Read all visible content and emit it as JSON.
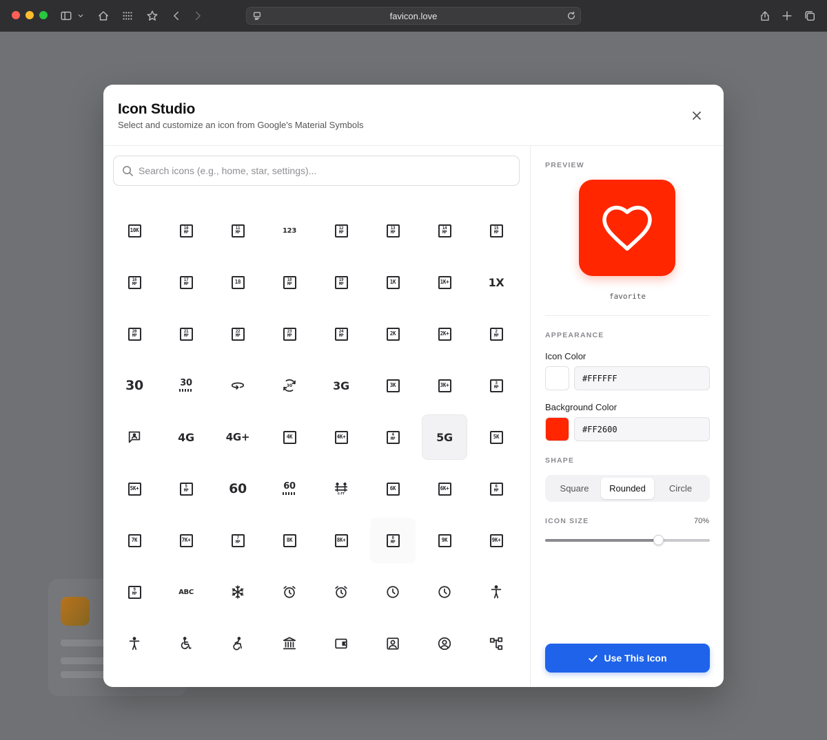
{
  "browser": {
    "url": "favicon.love"
  },
  "modal": {
    "title": "Icon Studio",
    "subtitle": "Select and customize an icon from Google's Material Symbols",
    "close_icon": "close-icon"
  },
  "search": {
    "placeholder": "Search icons (e.g., home, star, settings)...",
    "value": ""
  },
  "icons": [
    {
      "label": "10K",
      "kind": "box"
    },
    {
      "label": "10 MP",
      "kind": "boxmp"
    },
    {
      "label": "11 MP",
      "kind": "boxmp"
    },
    {
      "label": "123",
      "kind": "text",
      "size": 10
    },
    {
      "label": "12 MP",
      "kind": "boxmp"
    },
    {
      "label": "13 MP",
      "kind": "boxmp"
    },
    {
      "label": "14 MP",
      "kind": "boxmp"
    },
    {
      "label": "15 MP",
      "kind": "boxmp"
    },
    {
      "label": "16 MP",
      "kind": "boxmp"
    },
    {
      "label": "17 MP",
      "kind": "boxmp"
    },
    {
      "label": "18",
      "kind": "box"
    },
    {
      "label": "18 MP",
      "kind": "boxmp"
    },
    {
      "label": "19 MP",
      "kind": "boxmp"
    },
    {
      "label": "1K",
      "kind": "box"
    },
    {
      "label": "1K+",
      "kind": "box"
    },
    {
      "label": "1X",
      "kind": "text",
      "size": 16
    },
    {
      "label": "20 MP",
      "kind": "boxmp"
    },
    {
      "label": "21 MP",
      "kind": "boxmp"
    },
    {
      "label": "22 MP",
      "kind": "boxmp"
    },
    {
      "label": "23 MP",
      "kind": "boxmp"
    },
    {
      "label": "24 MP",
      "kind": "boxmp"
    },
    {
      "label": "2K",
      "kind": "box"
    },
    {
      "label": "2K+",
      "kind": "box"
    },
    {
      "label": "2 MP",
      "kind": "boxmp"
    },
    {
      "label": "30",
      "kind": "text",
      "size": 19
    },
    {
      "label": "30",
      "kind": "text30"
    },
    {
      "label": "360",
      "kind": "svg",
      "svg": "rot360"
    },
    {
      "label": "3D",
      "kind": "svg",
      "svg": "rot3d"
    },
    {
      "label": "3G",
      "kind": "text",
      "size": 16
    },
    {
      "label": "3K",
      "kind": "box"
    },
    {
      "label": "3K+",
      "kind": "box"
    },
    {
      "label": "3 MP",
      "kind": "boxmp"
    },
    {
      "label": "",
      "kind": "svg",
      "svg": "chatperson"
    },
    {
      "label": "4G",
      "kind": "text",
      "size": 16
    },
    {
      "label": "4G+",
      "kind": "text",
      "size": 15
    },
    {
      "label": "4K",
      "kind": "box"
    },
    {
      "label": "4K+",
      "kind": "box"
    },
    {
      "label": "4 MP",
      "kind": "boxmp"
    },
    {
      "label": "5G",
      "kind": "text",
      "size": 16
    },
    {
      "label": "5K",
      "kind": "box"
    },
    {
      "label": "5K+",
      "kind": "box"
    },
    {
      "label": "5 MP",
      "kind": "boxmp"
    },
    {
      "label": "60",
      "kind": "text",
      "size": 19
    },
    {
      "label": "60",
      "kind": "text30"
    },
    {
      "label": "6 FT",
      "kind": "svg",
      "svg": "sixft"
    },
    {
      "label": "6K",
      "kind": "box"
    },
    {
      "label": "6K+",
      "kind": "box"
    },
    {
      "label": "6 MP",
      "kind": "boxmp"
    },
    {
      "label": "7K",
      "kind": "box"
    },
    {
      "label": "7K+",
      "kind": "box"
    },
    {
      "label": "7 MP",
      "kind": "boxmp"
    },
    {
      "label": "8K",
      "kind": "box"
    },
    {
      "label": "8K+",
      "kind": "box"
    },
    {
      "label": "8 MP",
      "kind": "boxmp"
    },
    {
      "label": "9K",
      "kind": "box"
    },
    {
      "label": "9K+",
      "kind": "box"
    },
    {
      "label": "9 MP",
      "kind": "boxmp"
    },
    {
      "label": "ABC",
      "kind": "text",
      "size": 10
    },
    {
      "label": "",
      "kind": "svg",
      "svg": "snow"
    },
    {
      "label": "",
      "kind": "svg",
      "svg": "alarm"
    },
    {
      "label": "",
      "kind": "svg",
      "svg": "alarm"
    },
    {
      "label": "",
      "kind": "svg",
      "svg": "clock"
    },
    {
      "label": "",
      "kind": "svg",
      "svg": "clock"
    },
    {
      "label": "",
      "kind": "svg",
      "svg": "accessibility"
    },
    {
      "label": "",
      "kind": "svg",
      "svg": "accessibility"
    },
    {
      "label": "",
      "kind": "svg",
      "svg": "wheelchair"
    },
    {
      "label": "",
      "kind": "svg",
      "svg": "wheelchair2"
    },
    {
      "label": "",
      "kind": "svg",
      "svg": "bank"
    },
    {
      "label": "",
      "kind": "svg",
      "svg": "wallet"
    },
    {
      "label": "",
      "kind": "svg",
      "svg": "accountbox"
    },
    {
      "label": "",
      "kind": "svg",
      "svg": "accountcircle"
    },
    {
      "label": "",
      "kind": "svg",
      "svg": "tree"
    }
  ],
  "selected_icon_index": 38,
  "hovered_icon_index": 53,
  "preview": {
    "section_label": "PREVIEW",
    "icon_name": "favorite"
  },
  "appearance": {
    "section_label": "APPEARANCE",
    "icon_color_label": "Icon Color",
    "icon_color": "#FFFFFF",
    "background_color_label": "Background Color",
    "background_color": "#FF2600"
  },
  "shape": {
    "section_label": "SHAPE",
    "options": [
      "Square",
      "Rounded",
      "Circle"
    ],
    "selected": "Rounded"
  },
  "icon_size": {
    "section_label": "ICON SIZE",
    "value_text": "70%",
    "value": 0.7
  },
  "use_button": {
    "label": "Use This Icon"
  }
}
